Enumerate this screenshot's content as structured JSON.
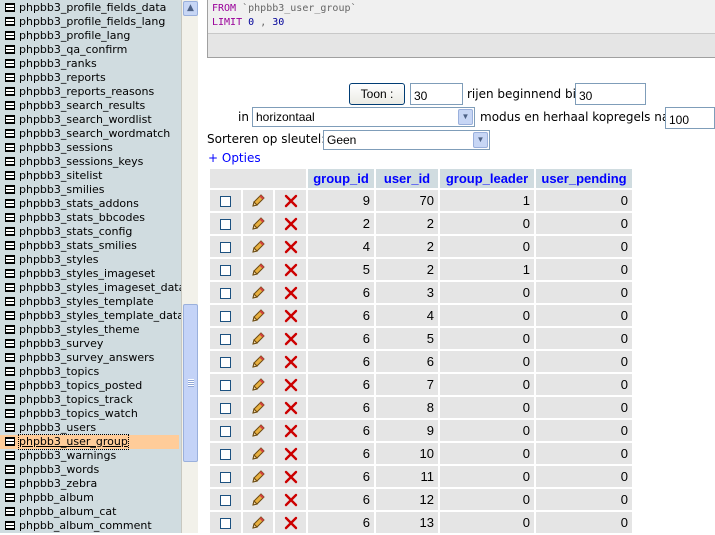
{
  "sidebar": {
    "tables": [
      "phpbb3_profile_fields_data",
      "phpbb3_profile_fields_lang",
      "phpbb3_profile_lang",
      "phpbb3_qa_confirm",
      "phpbb3_ranks",
      "phpbb3_reports",
      "phpbb3_reports_reasons",
      "phpbb3_search_results",
      "phpbb3_search_wordlist",
      "phpbb3_search_wordmatch",
      "phpbb3_sessions",
      "phpbb3_sessions_keys",
      "phpbb3_sitelist",
      "phpbb3_smilies",
      "phpbb3_stats_addons",
      "phpbb3_stats_bbcodes",
      "phpbb3_stats_config",
      "phpbb3_stats_smilies",
      "phpbb3_styles",
      "phpbb3_styles_imageset",
      "phpbb3_styles_imageset_data",
      "phpbb3_styles_template",
      "phpbb3_styles_template_data",
      "phpbb3_styles_theme",
      "phpbb3_survey",
      "phpbb3_survey_answers",
      "phpbb3_topics",
      "phpbb3_topics_posted",
      "phpbb3_topics_track",
      "phpbb3_topics_watch",
      "phpbb3_users",
      "phpbb3_user_group",
      "phpbb3_warnings",
      "phpbb3_words",
      "phpbb3_zebra",
      "phpbb_album",
      "phpbb_album_cat",
      "phpbb_album_comment"
    ],
    "selected": "phpbb3_user_group"
  },
  "sql": {
    "from_kw": "FROM",
    "table": "`phpbb3_user_group`",
    "limit_kw": "LIMIT",
    "offset": "0",
    "comma": ",",
    "count": "30"
  },
  "controls": {
    "show_button": "Toon :",
    "rows_value": "30",
    "rows_label": "rijen beginnend bij",
    "start_value": "30",
    "in_label": "in",
    "mode_value": "horizontaal",
    "mode_label": "modus en herhaal kopregels na",
    "repeat_value": "100",
    "sort_label": "Sorteren op sleutel:",
    "sort_value": "Geen",
    "options_link": "+ Opties"
  },
  "table": {
    "columns": [
      "group_id",
      "user_id",
      "group_leader",
      "user_pending"
    ],
    "rows": [
      [
        "9",
        "70",
        "1",
        "0"
      ],
      [
        "2",
        "2",
        "0",
        "0"
      ],
      [
        "4",
        "2",
        "0",
        "0"
      ],
      [
        "5",
        "2",
        "1",
        "0"
      ],
      [
        "6",
        "3",
        "0",
        "0"
      ],
      [
        "6",
        "4",
        "0",
        "0"
      ],
      [
        "6",
        "5",
        "0",
        "0"
      ],
      [
        "6",
        "6",
        "0",
        "0"
      ],
      [
        "6",
        "7",
        "0",
        "0"
      ],
      [
        "6",
        "8",
        "0",
        "0"
      ],
      [
        "6",
        "9",
        "0",
        "0"
      ],
      [
        "6",
        "10",
        "0",
        "0"
      ],
      [
        "6",
        "11",
        "0",
        "0"
      ],
      [
        "6",
        "12",
        "0",
        "0"
      ],
      [
        "6",
        "13",
        "0",
        "0"
      ]
    ]
  },
  "colors": {
    "header_bg": "#D0DCE0",
    "row_bg": "#E5E5E5",
    "selected_bg": "#FFCC99",
    "link": "#0000FF",
    "delete": "#CC0000"
  }
}
